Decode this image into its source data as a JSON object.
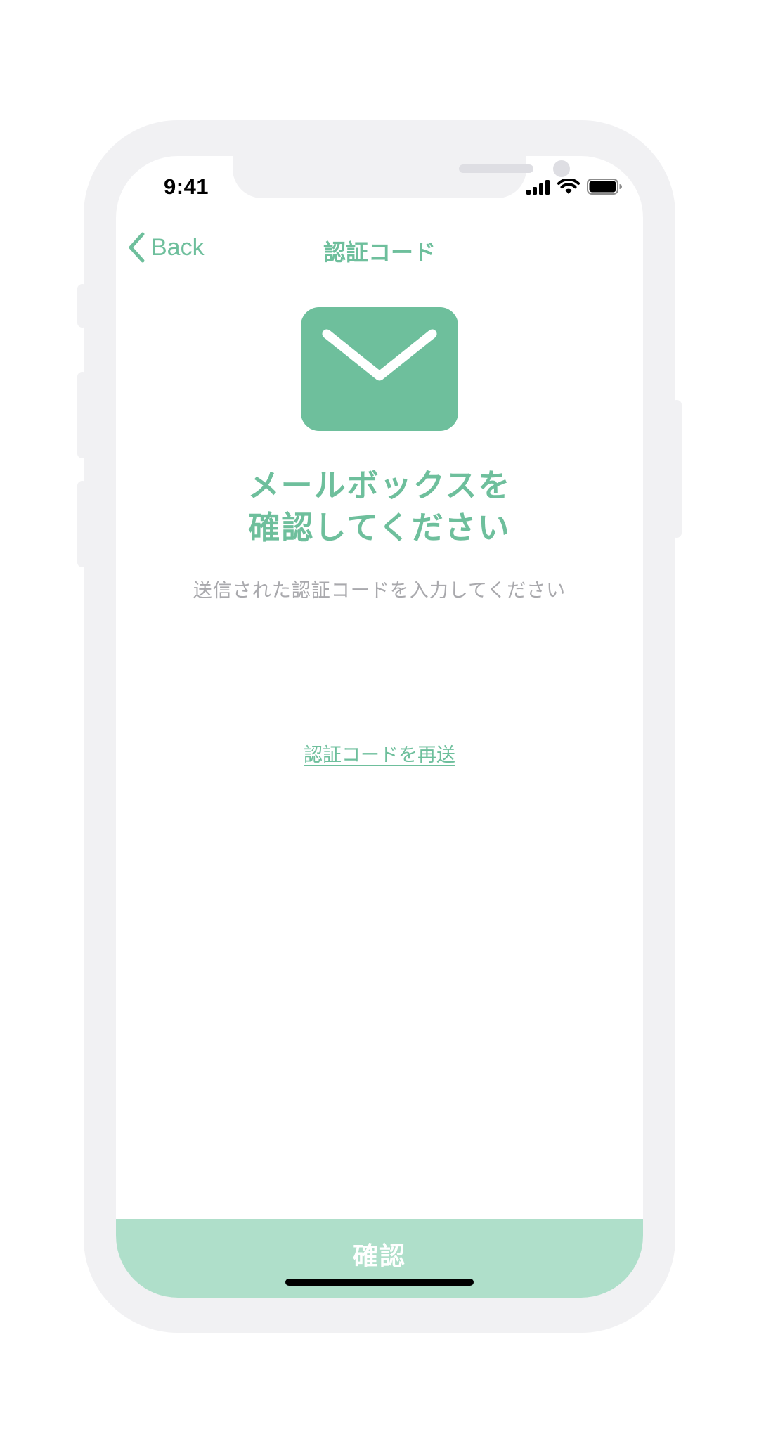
{
  "status_bar": {
    "time": "9:41",
    "icons": [
      "cellular-signal-icon",
      "wifi-icon",
      "battery-icon"
    ]
  },
  "nav": {
    "back_label": "Back",
    "title": "認証コード",
    "back_icon": "chevron-left-icon"
  },
  "content": {
    "icon": "mail-envelope-icon",
    "headline_line1": "メールボックスを",
    "headline_line2": "確認してください",
    "subtext": "送信された認証コードを入力してください",
    "code_input_value": "",
    "resend_label": "認証コードを再送"
  },
  "footer": {
    "confirm_label": "確認"
  },
  "colors": {
    "accent": "#6ebf9c",
    "button_disabled": "#afdfca",
    "subtext": "#a9a9ad",
    "frame": "#f1f1f3"
  }
}
